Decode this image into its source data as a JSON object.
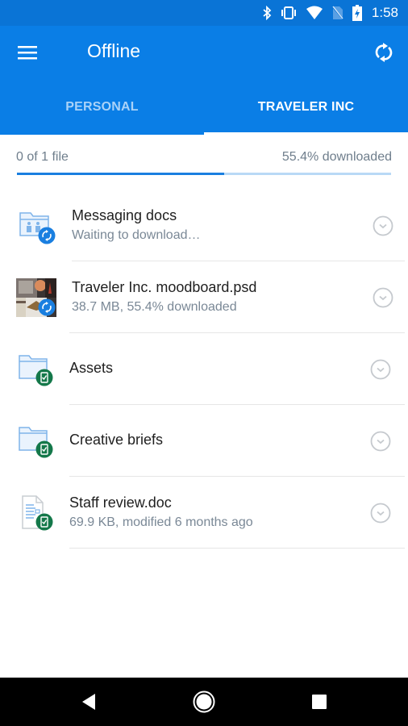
{
  "status_bar": {
    "time": "1:58",
    "icons": [
      "bluetooth-icon",
      "vibrate-icon",
      "wifi-icon",
      "no-sim-icon",
      "battery-charging-icon"
    ]
  },
  "app_bar": {
    "title": "Offline",
    "menu_icon": "menu-icon",
    "sync_icon": "sync-icon"
  },
  "tabs": [
    {
      "label": "PERSONAL",
      "active": false
    },
    {
      "label": "TRAVELER INC",
      "active": true
    }
  ],
  "progress": {
    "files_label": "0 of 1 file",
    "percent_label": "55.4% downloaded",
    "percent": 55.4
  },
  "colors": {
    "accent": "#0a7ee6",
    "status_bar": "#0a74d6",
    "sync_badge": "#1a7fe0",
    "offline_badge": "#14784a"
  },
  "items": [
    {
      "name": "Messaging docs",
      "subtitle": "Waiting to download…",
      "icon": "shared-folder-icon",
      "badge": "sync-badge-icon"
    },
    {
      "name": "Traveler Inc. moodboard.psd",
      "subtitle": "38.7 MB, 55.4% downloaded",
      "icon": "image-thumbnail",
      "badge": "sync-badge-icon"
    },
    {
      "name": "Assets",
      "subtitle": "",
      "icon": "folder-icon",
      "badge": "offline-badge-icon"
    },
    {
      "name": "Creative briefs",
      "subtitle": "",
      "icon": "folder-icon",
      "badge": "offline-badge-icon"
    },
    {
      "name": "Staff review.doc",
      "subtitle": "69.9 KB, modified 6 months ago",
      "icon": "document-icon",
      "badge": "offline-badge-icon"
    }
  ],
  "nav_bar": {
    "buttons": [
      "back-icon",
      "home-icon",
      "recents-icon"
    ]
  }
}
